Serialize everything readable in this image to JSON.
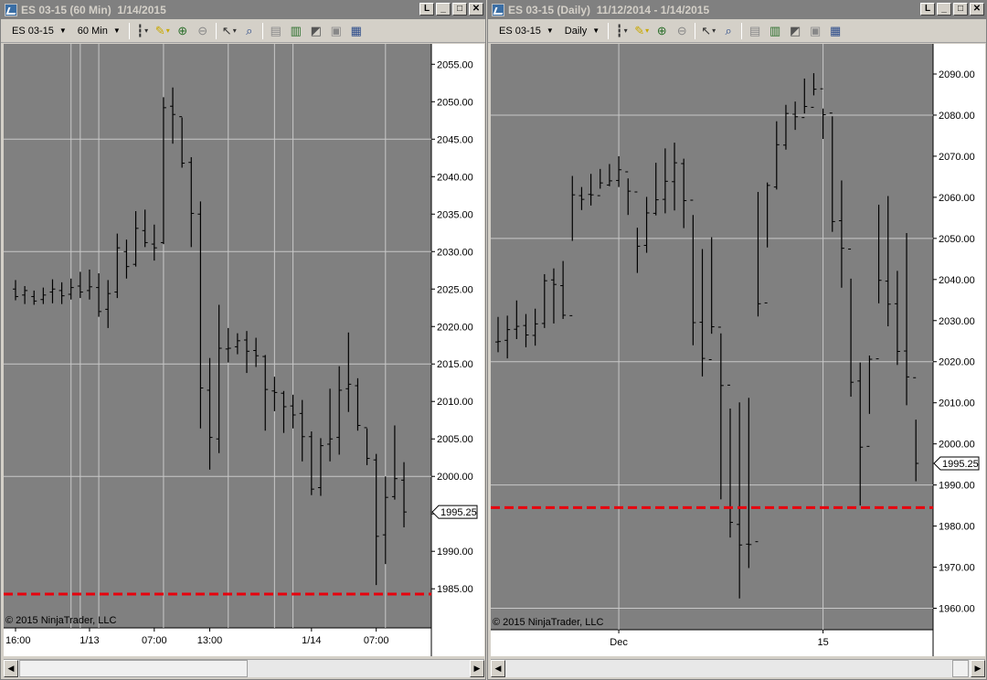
{
  "windows": [
    {
      "id": "left",
      "title": "ES 03-15 (60 Min)  1/14/2015",
      "window_buttons": [
        "L",
        "_",
        "□",
        "✕"
      ],
      "toolbar": {
        "instrument": "ES 03-15",
        "interval": "60 Min"
      },
      "copyright": "© 2015 NinjaTrader, LLC",
      "chart_data": {
        "type": "ohlc",
        "ylim": [
          1981.0,
          2056.5
        ],
        "y_ticks": [
          "2055.00",
          "2050.00",
          "2045.00",
          "2040.00",
          "2035.00",
          "2030.00",
          "2025.00",
          "2020.00",
          "2015.00",
          "2010.00",
          "2005.00",
          "2000.00",
          "1995.00",
          "1990.00",
          "1985.00"
        ],
        "x_ticks": [
          "16:00",
          "1/13",
          "07:00",
          "13:00",
          "1/14",
          "07:00"
        ],
        "x_tick_bars": [
          0,
          8,
          15,
          21,
          32,
          39
        ],
        "current_price": "1995.25",
        "level_line": 1984.3,
        "level_color": "#e8000d",
        "h_grid": [
          2045,
          2030,
          2015,
          2000
        ],
        "v_grid_bars": [
          6,
          7,
          9,
          16,
          23,
          28,
          30,
          40
        ],
        "bars": [
          [
            2025.0,
            2026.2,
            2023.5,
            2024.0
          ],
          [
            2024.2,
            2025.4,
            2023.0,
            2024.8
          ],
          [
            2024.0,
            2024.8,
            2022.9,
            2023.4
          ],
          [
            2023.6,
            2025.2,
            2023.0,
            2024.2
          ],
          [
            2024.6,
            2026.3,
            2023.1,
            2025.0
          ],
          [
            2024.8,
            2025.9,
            2023.0,
            2024.1
          ],
          [
            2024.3,
            2026.4,
            2023.6,
            2025.2
          ],
          [
            2025.4,
            2027.3,
            2023.8,
            2024.6
          ],
          [
            2024.8,
            2027.6,
            2023.6,
            2025.3
          ],
          [
            2025.2,
            2027.1,
            2021.3,
            2022.0
          ],
          [
            2022.3,
            2026.2,
            2019.8,
            2024.4
          ],
          [
            2024.6,
            2032.4,
            2023.8,
            2030.5
          ],
          [
            2030.0,
            2031.6,
            2026.4,
            2028.0
          ],
          [
            2028.3,
            2035.4,
            2028.0,
            2033.1
          ],
          [
            2032.8,
            2035.6,
            2030.6,
            2031.2
          ],
          [
            2031.0,
            2033.6,
            2028.8,
            2030.5
          ],
          [
            2031.2,
            2050.6,
            2031.0,
            2049.2
          ],
          [
            2049.4,
            2051.9,
            2044.4,
            2048.3
          ],
          [
            2048.0,
            2047.9,
            2041.2,
            2041.8
          ],
          [
            2041.9,
            2042.6,
            2030.6,
            2035.1
          ],
          [
            2035.0,
            2036.7,
            2006.4,
            2011.8
          ],
          [
            2011.5,
            2015.8,
            2000.9,
            2005.2
          ],
          [
            2005.0,
            2022.9,
            2003.1,
            2017.1
          ],
          [
            2017.0,
            2019.8,
            2015.2,
            2017.1
          ],
          [
            2017.3,
            2019.1,
            2016.3,
            2018.1
          ],
          [
            2018.2,
            2019.4,
            2013.8,
            2016.7
          ],
          [
            2016.8,
            2018.5,
            2014.6,
            2016.1
          ],
          [
            2016.0,
            2016.2,
            2006.1,
            2011.6
          ],
          [
            2011.4,
            2013.3,
            2008.7,
            2011.2
          ],
          [
            2011.1,
            2011.4,
            2005.8,
            2009.3
          ],
          [
            2009.4,
            2010.9,
            2006.4,
            2008.2
          ],
          [
            2008.4,
            2010.2,
            2002.0,
            2005.3
          ],
          [
            2005.3,
            2006.0,
            1997.5,
            1998.3
          ],
          [
            1998.5,
            2005.1,
            1997.4,
            2004.1
          ],
          [
            2004.3,
            2011.7,
            2002.0,
            2005.0
          ],
          [
            2005.2,
            2014.7,
            2002.9,
            2011.5
          ],
          [
            2011.7,
            2019.2,
            2008.6,
            2012.3
          ],
          [
            2012.1,
            2013.1,
            2006.1,
            2006.8
          ],
          [
            2006.5,
            2006.4,
            2001.5,
            2002.4
          ],
          [
            2002.2,
            2003.0,
            1985.5,
            1992.0
          ],
          [
            1992.2,
            2000.0,
            1988.3,
            1997.2
          ],
          [
            1997.3,
            2006.8,
            1996.9,
            1999.7
          ],
          [
            1999.5,
            2001.9,
            1993.2,
            1995.25
          ]
        ]
      }
    },
    {
      "id": "right",
      "title": "ES 03-15 (Daily)  11/12/2014 - 1/14/2015",
      "window_buttons": [
        "L",
        "_",
        "□",
        "✕"
      ],
      "toolbar": {
        "instrument": "ES 03-15",
        "interval": "Daily"
      },
      "copyright": "© 2015 NinjaTrader, LLC",
      "chart_data": {
        "type": "ohlc",
        "ylim": [
          1957.0,
          2094.0
        ],
        "y_ticks": [
          "2090.00",
          "2080.00",
          "2070.00",
          "2060.00",
          "2050.00",
          "2040.00",
          "2030.00",
          "2020.00",
          "2010.00",
          "2000.00",
          "1990.00",
          "1980.00",
          "1970.00",
          "1960.00"
        ],
        "x_ticks": [
          "Dec",
          "15"
        ],
        "x_tick_bars": [
          13,
          35
        ],
        "current_price": "1995.25",
        "level_line": 1984.5,
        "level_color": "#e8000d",
        "h_grid": [
          2080,
          2050,
          2020,
          1990,
          1960
        ],
        "v_grid_bars": [
          13,
          35
        ],
        "bars": [
          [
            2024.8,
            2030.9,
            2022.3,
            2024.9
          ],
          [
            2025.2,
            2031.2,
            2020.8,
            2027.8
          ],
          [
            2027.9,
            2034.9,
            2025.5,
            2028.6
          ],
          [
            2028.8,
            2031.6,
            2023.5,
            2026.5
          ],
          [
            2026.4,
            2032.9,
            2023.9,
            2029.2
          ],
          [
            2029.3,
            2041.3,
            2028.2,
            2039.7
          ],
          [
            2039.9,
            2042.7,
            2029.3,
            2038.8
          ],
          [
            2038.5,
            2044.5,
            2030.4,
            2031.3
          ],
          [
            2031.2,
            2065.2,
            2049.4,
            2060.6
          ],
          [
            2060.4,
            2062.5,
            2056.9,
            2059.5
          ],
          [
            2060.7,
            2065.7,
            2058.0,
            2060.6
          ],
          [
            2060.4,
            2066.9,
            2062.1,
            2063.5
          ],
          [
            2063.0,
            2068.1,
            2062.7,
            2064.0
          ],
          [
            2064.1,
            2070.0,
            2062.5,
            2066.7
          ],
          [
            2066.2,
            2064.6,
            2055.7,
            2061.5
          ],
          [
            2061.3,
            2052.6,
            2041.6,
            2048.1
          ],
          [
            2048.3,
            2060.1,
            2046.5,
            2056.2
          ],
          [
            2056.1,
            2068.4,
            2055.6,
            2059.4
          ],
          [
            2059.5,
            2071.9,
            2056.1,
            2063.9
          ],
          [
            2063.8,
            2073.3,
            2056.8,
            2068.4
          ],
          [
            2068.2,
            2069.4,
            2052.5,
            2059.2
          ],
          [
            2059.3,
            2055.7,
            2024.0,
            2029.5
          ],
          [
            2029.6,
            2047.4,
            2016.4,
            2020.8
          ],
          [
            2020.5,
            2050.3,
            2026.8,
            2028.5
          ],
          [
            2028.4,
            2026.9,
            1986.5,
            2014.2
          ],
          [
            2014.3,
            2008.6,
            1977.2,
            1980.9
          ],
          [
            1980.4,
            2010.1,
            1962.4,
            1975.4
          ],
          [
            1975.6,
            2011.2,
            1969.8,
            1975.5
          ],
          [
            1976.2,
            2061.3,
            2031.0,
            2034.1
          ],
          [
            2034.3,
            2063.6,
            2047.8,
            2062.9
          ],
          [
            2062.5,
            2078.5,
            2061.9,
            2072.8
          ],
          [
            2072.7,
            2082.5,
            2071.6,
            2080.4
          ],
          [
            2080.2,
            2083.3,
            2076.4,
            2079.6
          ],
          [
            2079.4,
            2088.9,
            2080.4,
            2082.1
          ],
          [
            2081.9,
            2090.2,
            2084.8,
            2086.3
          ],
          [
            2086.4,
            2081.6,
            2074.2,
            2080.1
          ],
          [
            2080.5,
            2079.7,
            2051.6,
            2054.1
          ],
          [
            2054.3,
            2064.1,
            2038.0,
            2047.6
          ],
          [
            2047.4,
            2040.2,
            2011.5,
            2015.0
          ],
          [
            2015.3,
            2019.8,
            1985.0,
            1999.2
          ],
          [
            1999.4,
            2021.5,
            2007.3,
            2020.6
          ],
          [
            2020.7,
            2058.2,
            2034.2,
            2039.8
          ],
          [
            2039.6,
            2060.3,
            2028.6,
            2034.0
          ],
          [
            2034.1,
            2042.1,
            2019.2,
            2022.5
          ],
          [
            2022.6,
            2051.3,
            2009.4,
            2016.3
          ],
          [
            2016.1,
            2005.9,
            1990.9,
            1995.25
          ]
        ]
      }
    }
  ]
}
